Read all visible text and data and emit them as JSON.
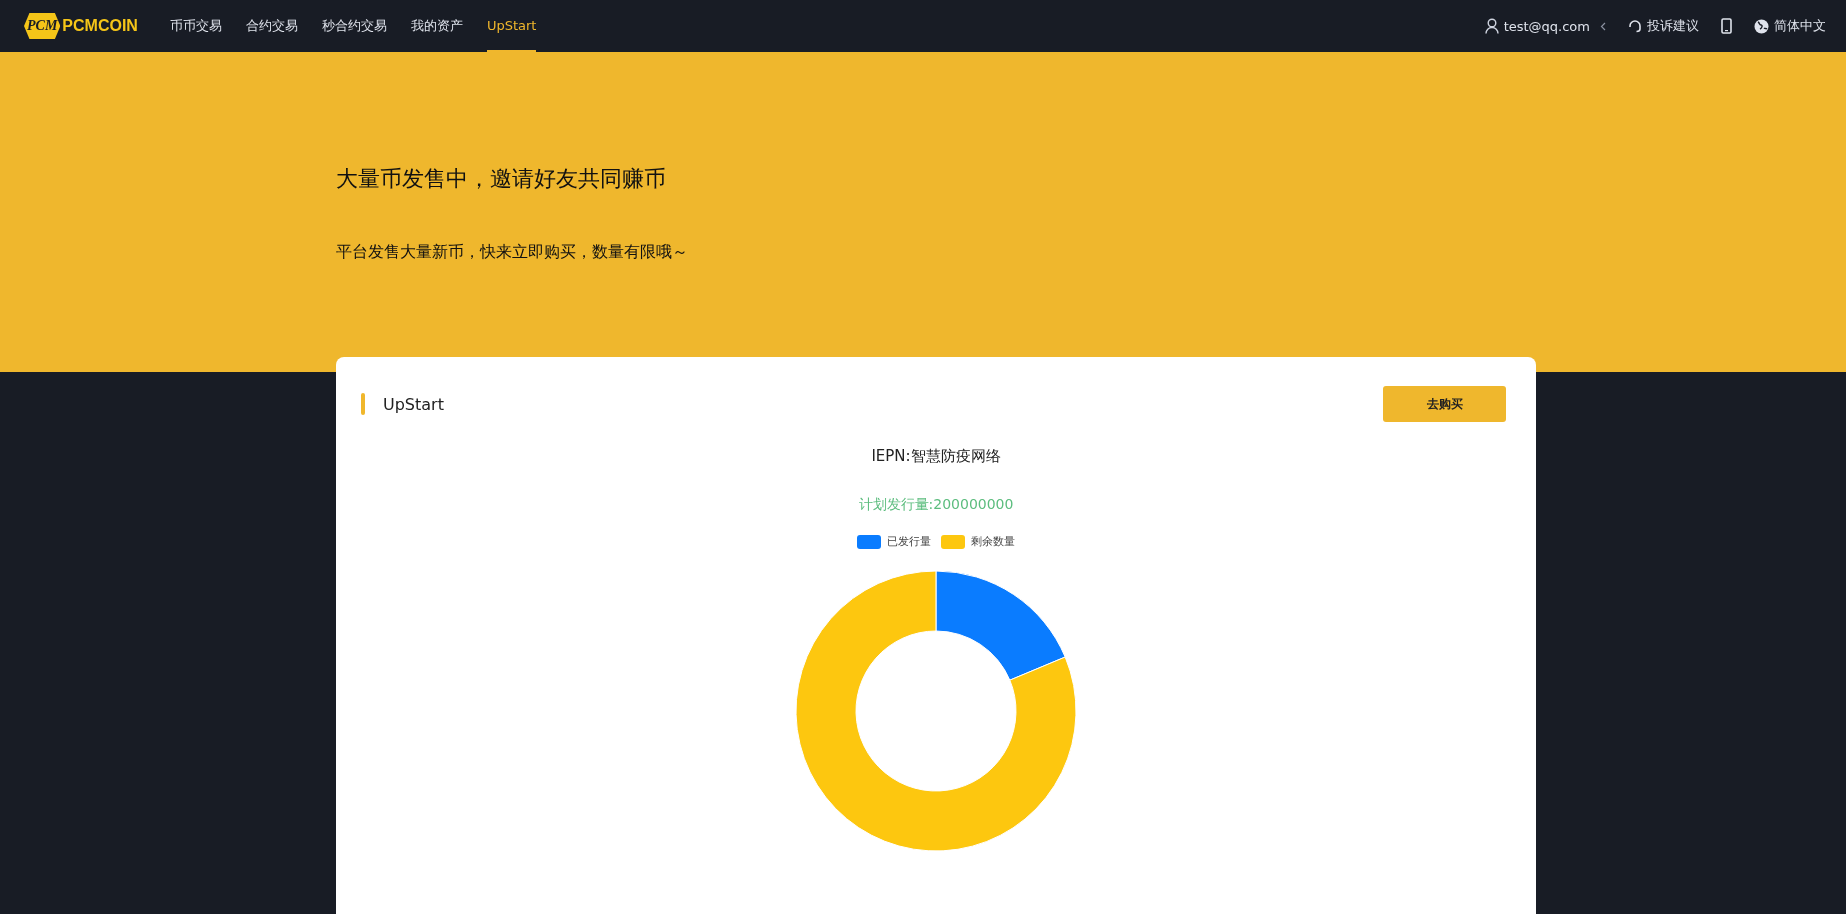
{
  "nav": {
    "logo": "PCMCOIN",
    "logo_badge": "PCM",
    "items": [
      {
        "label": "币币交易",
        "selected": false
      },
      {
        "label": "合约交易",
        "selected": false
      },
      {
        "label": "秒合约交易",
        "selected": false
      },
      {
        "label": "我的资产",
        "selected": false
      },
      {
        "label": "UpStart",
        "selected": true
      }
    ],
    "user": "test@qq.com",
    "feedback": "投诉建议",
    "language": "简体中文"
  },
  "banner": {
    "title": "大量币发售中，邀请好友共同赚币",
    "subtitle": "平台发售大量新币，快来立即购买，数量有限哦～"
  },
  "card": {
    "title": "UpStart",
    "button": "去购买",
    "chart_title": "IEPN:智慧防疫网络",
    "plan": "计划发行量:200000000",
    "legend": [
      {
        "label": "已发行量",
        "color": "#0a7cff"
      },
      {
        "label": "剩余数量",
        "color": "#fdc70f"
      }
    ]
  }
}
